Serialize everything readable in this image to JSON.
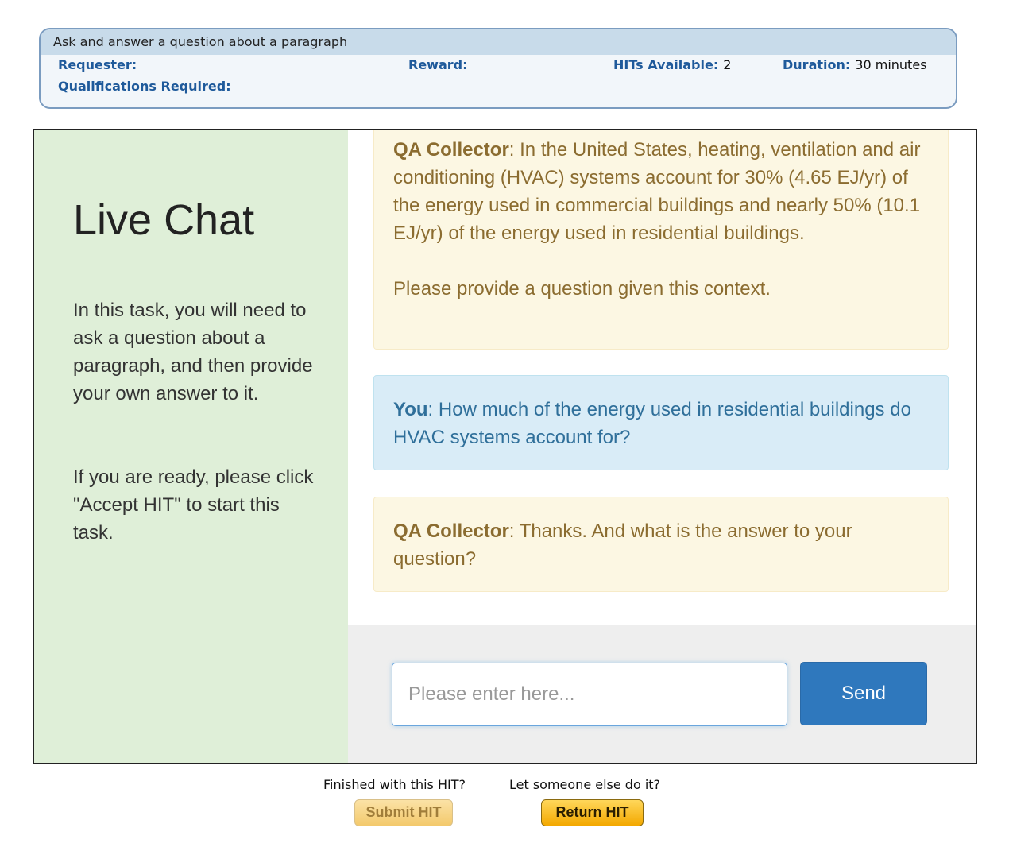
{
  "hit": {
    "title": "Ask and answer a question about a paragraph",
    "requester_label": "Requester:",
    "requester_value": "",
    "reward_label": "Reward:",
    "reward_value": "",
    "hits_available_label": "HITs Available:",
    "hits_available_value": "2",
    "duration_label": "Duration:",
    "duration_value": "30 minutes",
    "qualifications_label": "Qualifications Required:"
  },
  "sidebar": {
    "title": "Live Chat",
    "instructions": "In this task, you will need to ask a question about a paragraph, and then provide your own answer to it.",
    "ready_text": "If you are ready, please click \"Accept HIT\" to start this task."
  },
  "messages": [
    {
      "speaker": "QA Collector",
      "role": "bot",
      "text": "In the United States, heating, ventilation and air conditioning (HVAC) systems account for 30% (4.65 EJ/yr) of the energy used in commercial buildings and nearly 50% (10.1 EJ/yr) of the energy used in residential buildings.",
      "followup": "Please provide a question given this context."
    },
    {
      "speaker": "You",
      "role": "user",
      "text": "How much of the energy used in residential buildings do HVAC systems account for?"
    },
    {
      "speaker": "QA Collector",
      "role": "bot",
      "text": "Thanks. And what is the answer to your question?"
    }
  ],
  "chat_input": {
    "placeholder": "Please enter here...",
    "value": ""
  },
  "send_label": "Send",
  "footer": {
    "finished_text": "Finished with this HIT?",
    "return_text": "Let someone else do it?",
    "submit_label": "Submit HIT",
    "return_label": "Return HIT"
  },
  "colors": {
    "sidebar_bg": "#dfefd8",
    "bot_msg_bg": "#fcf7e3",
    "bot_msg_text": "#8b6c30",
    "user_msg_bg": "#d9ecf7",
    "user_msg_text": "#2f6f9a",
    "send_button": "#2f78bd",
    "hit_label": "#1f5a9b"
  }
}
